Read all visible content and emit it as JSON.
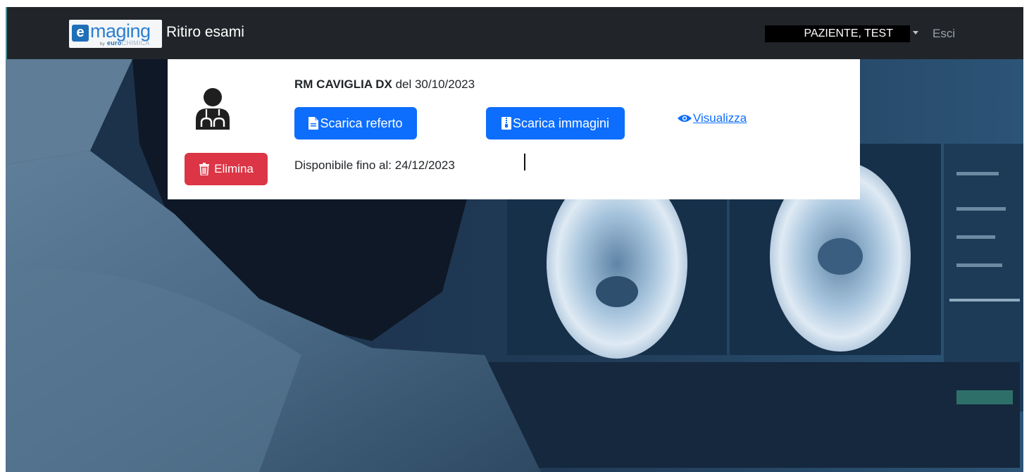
{
  "navbar": {
    "logo": {
      "letter": "e",
      "word": "maging",
      "by": "by",
      "brand_part1": "euro",
      "brand_part2": "CHIMICA"
    },
    "title": "Ritiro esami",
    "user": "PAZIENTE, TEST",
    "logout": "Esci"
  },
  "exam": {
    "name": "RM CAVIGLIA DX",
    "date_text": " del 30/10/2023",
    "download_report_label": "Scarica referto",
    "download_images_label": "Scarica immagini",
    "view_label": "Visualizza",
    "delete_label": "Elimina",
    "available_text": "Disponibile fino al: 24/12/2023"
  },
  "icons": {
    "avatar": "doctor-icon",
    "delete": "trash-icon",
    "report": "file-icon",
    "images": "file-zip-icon",
    "view": "eye-icon",
    "user_menu": "caret-down-icon"
  },
  "colors": {
    "navbar": "#212529",
    "primary": "#0d6efd",
    "danger": "#dc3545",
    "link": "#0d6efd"
  }
}
